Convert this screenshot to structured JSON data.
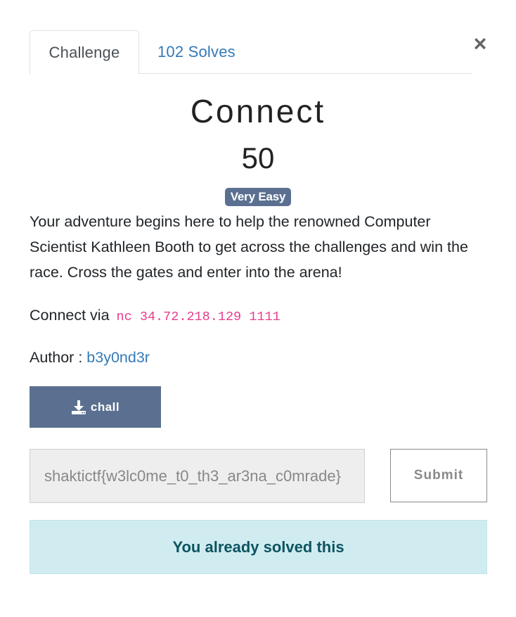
{
  "tabs": {
    "challenge_label": "Challenge",
    "solves_label": "102 Solves"
  },
  "close_glyph": "×",
  "challenge": {
    "name": "Connect",
    "points": "50",
    "difficulty": "Very Easy",
    "description": "Your adventure begins here to help the renowned Computer Scientist Kathleen Booth to get across the challenges and win the race. Cross the gates and enter into the arena!",
    "connect_prefix": "Connect via",
    "connect_command": "nc 34.72.218.129 1111",
    "author_prefix": "Author :",
    "author_name": "b3y0nd3r"
  },
  "download": {
    "label": "chall",
    "icon": "download-icon"
  },
  "flag_form": {
    "value": "shaktictf{w3lc0me_t0_th3_ar3na_c0mrade}",
    "submit_label": "Submit"
  },
  "status": {
    "message": "You already solved this"
  },
  "colors": {
    "accent": "#5b7090",
    "link": "#337ab7",
    "code": "#e83e8c",
    "alert_bg": "#d1ecf1",
    "alert_text": "#0c5460"
  }
}
